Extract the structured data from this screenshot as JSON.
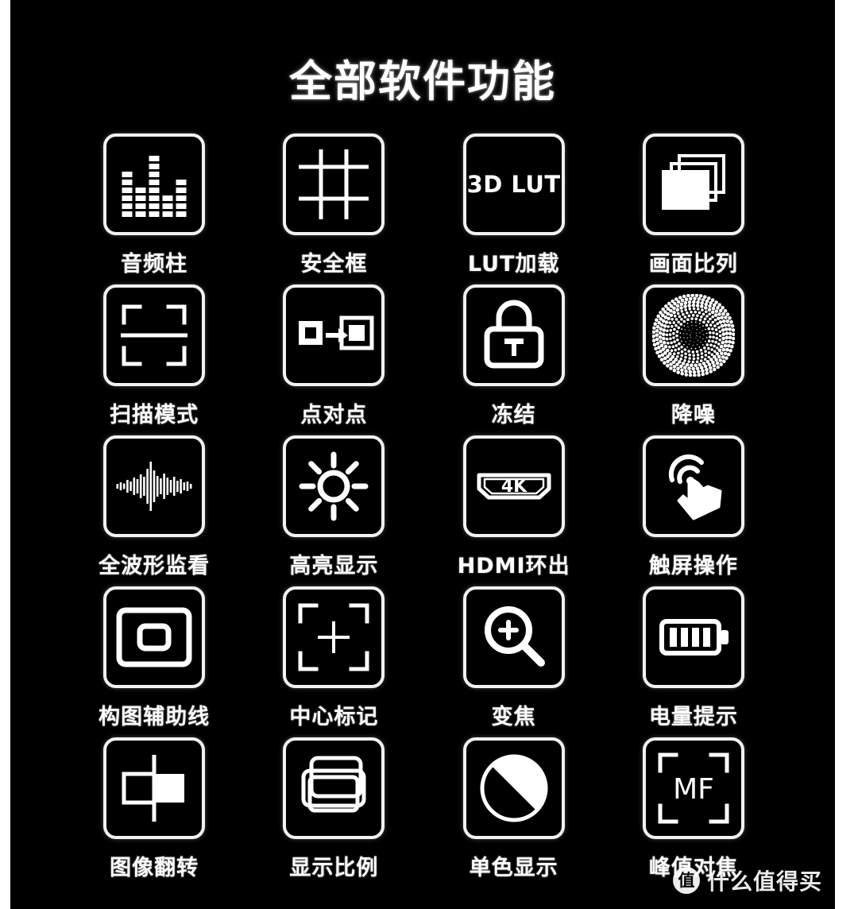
{
  "page": {
    "title": "全部软件功能",
    "background_color": "#000000",
    "foreground_color": "#ffffff",
    "page_margin_color": "#ffffff"
  },
  "watermark": {
    "badge_text": "值",
    "text": "什么值得买"
  },
  "features": [
    {
      "label": "音频柱",
      "icon": "audio-bars-icon"
    },
    {
      "label": "安全框",
      "icon": "safe-frame-grid-icon"
    },
    {
      "label": "LUT加载",
      "icon": "3d-lut-icon",
      "icon_text": "3D LUT"
    },
    {
      "label": "画面比列",
      "icon": "aspect-stack-icon"
    },
    {
      "label": "扫描模式",
      "icon": "scan-mode-icon"
    },
    {
      "label": "点对点",
      "icon": "pixel-to-pixel-icon"
    },
    {
      "label": "冻结",
      "icon": "lock-freeze-icon"
    },
    {
      "label": "降噪",
      "icon": "noise-reduction-icon"
    },
    {
      "label": "全波形监看",
      "icon": "waveform-icon"
    },
    {
      "label": "高亮显示",
      "icon": "brightness-sun-icon"
    },
    {
      "label": "HDMI环出",
      "icon": "hdmi-port-icon",
      "icon_text": "4K"
    },
    {
      "label": "触屏操作",
      "icon": "touch-hand-icon"
    },
    {
      "label": "构图辅助线",
      "icon": "composition-guides-icon"
    },
    {
      "label": "中心标记",
      "icon": "center-marker-icon"
    },
    {
      "label": "变焦",
      "icon": "zoom-magnifier-icon"
    },
    {
      "label": "电量提示",
      "icon": "battery-icon"
    },
    {
      "label": "图像翻转",
      "icon": "image-flip-icon"
    },
    {
      "label": "显示比例",
      "icon": "display-ratio-icon"
    },
    {
      "label": "单色显示",
      "icon": "monochrome-circle-icon"
    },
    {
      "label": "峰值对焦",
      "icon": "manual-focus-icon",
      "icon_text": "MF"
    }
  ]
}
